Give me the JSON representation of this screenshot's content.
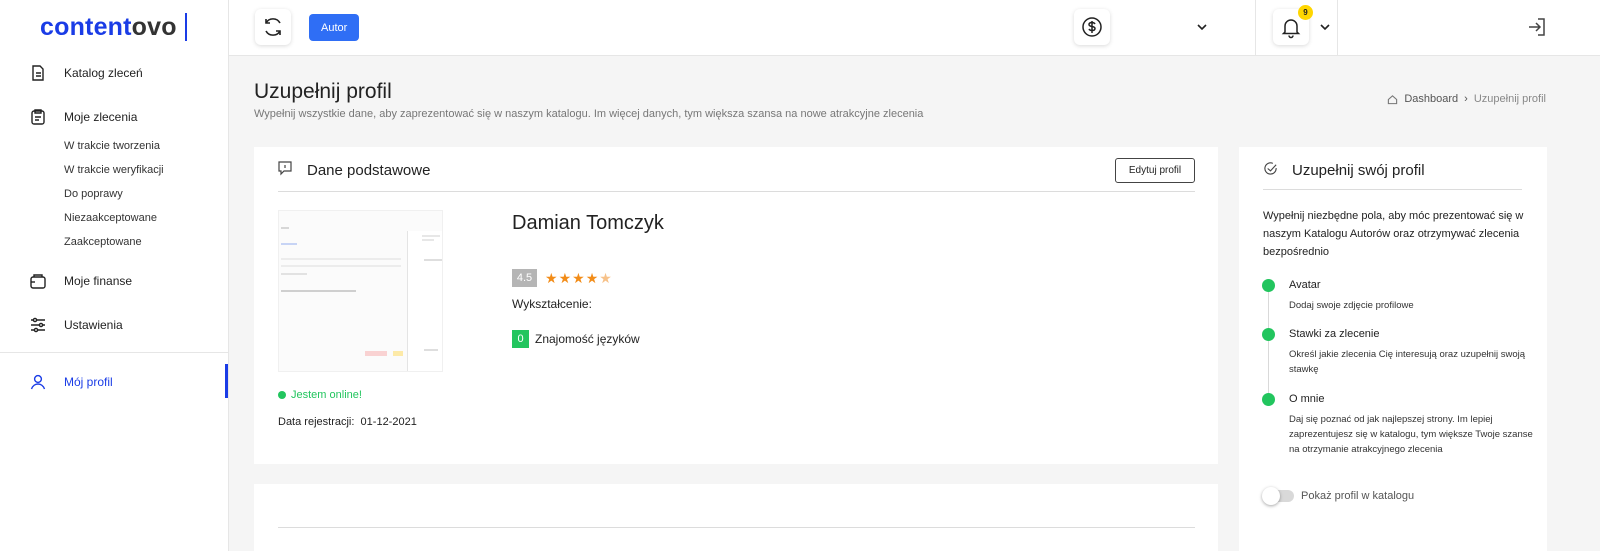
{
  "brand": {
    "part1": "content",
    "part2": "ovo"
  },
  "sidebar": {
    "items": [
      {
        "label": "Katalog zleceń"
      },
      {
        "label": "Moje zlecenia"
      },
      {
        "label": "Moje finanse"
      },
      {
        "label": "Ustawienia"
      },
      {
        "label": "Mój profil"
      }
    ],
    "subitems": [
      {
        "label": "W trakcie tworzenia"
      },
      {
        "label": "W trakcie weryfikacji"
      },
      {
        "label": "Do poprawy"
      },
      {
        "label": "Niezaakceptowane"
      },
      {
        "label": "Zaakceptowane"
      }
    ]
  },
  "topbar": {
    "role": "Autor",
    "notifications": "9"
  },
  "header": {
    "title": "Uzupełnij profil",
    "subtitle": "Wypełnij wszystkie dane, aby zaprezentować się w naszym katalogu. Im więcej danych, tym większa szansa na nowe atrakcyjne zlecenia",
    "breadcrumb": {
      "home": "Dashboard",
      "current": "Uzupełnij profil"
    }
  },
  "basic": {
    "title": "Dane podstawowe",
    "edit_label": "Edytuj profil",
    "name": "Damian Tomczyk",
    "rating": "4.5",
    "rating_value": 4.5,
    "education_label": "Wykształcenie:",
    "languages_count": "0",
    "languages_label": "Znajomość języków",
    "online_text": "Jestem online!",
    "reg_label": "Data rejestracji:",
    "reg_date": "01-12-2021"
  },
  "complete": {
    "title": "Uzupełnij swój profil",
    "description": "Wypełnij niezbędne pola, aby móc prezentować się w naszym Katalogu Autorów oraz otrzymywać zlecenia bezpośrednio",
    "steps": [
      {
        "title": "Avatar",
        "desc": "Dodaj swoje zdjęcie profilowe"
      },
      {
        "title": "Stawki za zlecenie",
        "desc": "Określ jakie zlecenia Cię interesują oraz uzupełnij swoją stawkę"
      },
      {
        "title": "O mnie",
        "desc": "Daj się poznać od jak najlepszej strony. Im lepiej zaprezentujesz się w katalogu, tym większe Twoje szanse na otrzymanie atrakcyjnego zlecenia"
      }
    ],
    "toggle_label": "Pokaż profil w katalogu"
  },
  "colors": {
    "accent": "#1a3ce6",
    "badge": "#2f6ef5",
    "success": "#22c55e",
    "star": "#f28c18",
    "notif": "#ffd600"
  }
}
